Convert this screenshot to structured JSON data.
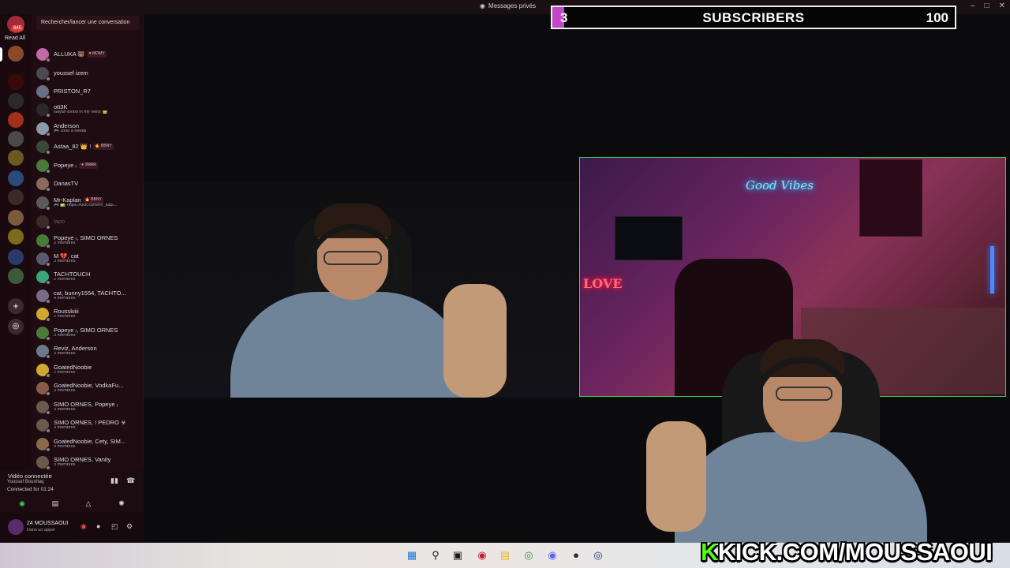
{
  "titlebar": {
    "title": "Messages privés"
  },
  "rail": {
    "home_badge": "845",
    "read_all": "Read All"
  },
  "dm_panel": {
    "search_placeholder": "Rechercher/lancer une conversation",
    "items": [
      {
        "name": "ALLUKA 🐻",
        "tag": "♥ MOMY",
        "sub": "",
        "color": "#c26aa8"
      },
      {
        "name": "youssef izem",
        "tag": "",
        "sub": "",
        "color": "#4a4a50"
      },
      {
        "name": "PRISTON_R7",
        "tag": "",
        "sub": "",
        "color": "#6a6f88"
      },
      {
        "name": "ott3K",
        "tag": "",
        "sub": "saiyan blood in my veins 👑",
        "color": "#2a2a2a"
      },
      {
        "name": "Anderson",
        "tag": "",
        "sub": "🎮 Joue à Medal",
        "color": "#8a9aaa"
      },
      {
        "name": "Astaa_82 👑 !",
        "tag": "🔥 BBNY",
        "sub": "",
        "color": "#3a4a3a"
      },
      {
        "name": "Popeye ᵣ",
        "tag": "✈ 9MAR",
        "sub": "",
        "color": "#4a7a3a"
      },
      {
        "name": "DanasTV",
        "tag": "",
        "sub": "",
        "color": "#8a6a5a"
      },
      {
        "name": "Mr-Kaplan",
        "tag": "🔥 BBNY",
        "sub": "🎮 ✅ https://kick.com/mr_kapl...",
        "color": "#5a5a5a"
      },
      {
        "name": "lapo",
        "tag": "",
        "sub": "",
        "color": "#3a2a2a",
        "dim": true
      },
      {
        "name": "Popeye ᵣ, SIMO ORNES",
        "tag": "",
        "sub": "3 membres",
        "color": "#4a7a3a"
      },
      {
        "name": "M 💔, cat",
        "tag": "",
        "sub": "3 membres",
        "color": "#5a5a6a"
      },
      {
        "name": "TACHTOUCH",
        "tag": "",
        "sub": "2 membres",
        "color": "#3aa57a"
      },
      {
        "name": "cat, bunny1554, TACHTO...",
        "tag": "",
        "sub": "4 membres",
        "color": "#7a6a8a"
      },
      {
        "name": "Rousskiiii",
        "tag": "",
        "sub": "2 membres",
        "color": "#d0a830"
      },
      {
        "name": "Popeye ᵣ, SIMO ORNES",
        "tag": "",
        "sub": "3 membres",
        "color": "#4a7a3a"
      },
      {
        "name": "Reviz, Anderson",
        "tag": "",
        "sub": "3 membres",
        "color": "#6a7a8a"
      },
      {
        "name": "GoatedNoobie",
        "tag": "",
        "sub": "2 membres",
        "color": "#d0a830"
      },
      {
        "name": "GoatedNoobie, VodkaFu...",
        "tag": "",
        "sub": "3 membres",
        "color": "#8a5a4a"
      },
      {
        "name": "SIMO ORNES, Popeye ᵣ",
        "tag": "",
        "sub": "3 membres",
        "color": "#6a5a4a"
      },
      {
        "name": "SIMO ORNES, ! PEDRO ☣",
        "tag": "",
        "sub": "3 membres",
        "color": "#6a5a4a"
      },
      {
        "name": "GoatedNoobie, Cety, SIM...",
        "tag": "",
        "sub": "4 membres",
        "color": "#8a6a4a"
      },
      {
        "name": "SIMO ORNES, Vanity",
        "tag": "",
        "sub": "3 membres",
        "color": "#6a5a4a"
      }
    ]
  },
  "voice": {
    "status": "Vidéo connectée",
    "user": "Youssef Boushaq",
    "time": "Connected for 01:24"
  },
  "user_panel": {
    "name": "24 MOUSSAOUI",
    "status": "Dans un appel"
  },
  "subscribers": {
    "current": "3",
    "label": "SUBSCRIBERS",
    "goal": "100",
    "progress": 0.03
  },
  "stream_second": {
    "neon_sign": "Good Vibes",
    "neon_love": "LOVE"
  },
  "overlay": {
    "kick_k": "K",
    "kick_url": "KICK.COM/MOUSSAOUI"
  },
  "colors": {
    "accent_purple": "#c248c8",
    "kick_green": "#53fc18",
    "video_border": "#3bd15e"
  }
}
